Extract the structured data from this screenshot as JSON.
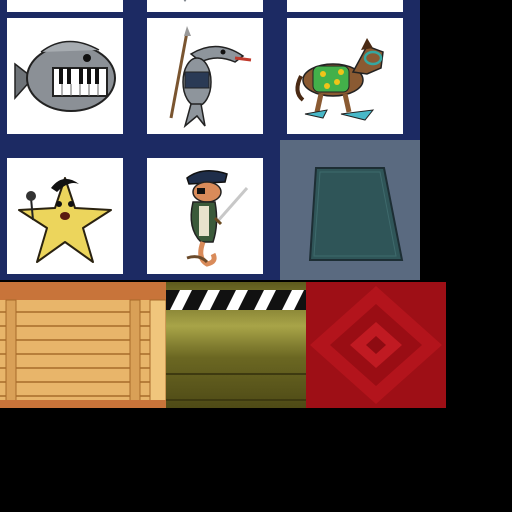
{
  "scene": "texture-atlas",
  "background_color": "#000000",
  "grid_line_color": "#1c2a63",
  "cards": [
    {
      "id": "card-top-left-peek",
      "icon": "partial-character-icon"
    },
    {
      "id": "card-top-middle-peek",
      "icon": "partial-character-icon"
    },
    {
      "id": "card-top-right-peek",
      "icon": "blank"
    },
    {
      "id": "piano-fish",
      "icon": "piano-fish-icon"
    },
    {
      "id": "swordfish-warrior",
      "icon": "swordfish-warrior-icon"
    },
    {
      "id": "scuba-horse",
      "icon": "scuba-horse-icon"
    },
    {
      "id": "elvis-starfish",
      "icon": "elvis-starfish-icon"
    },
    {
      "id": "pirate-seahorse",
      "icon": "pirate-seahorse-icon"
    }
  ],
  "tiles": [
    {
      "id": "empty-card-slot",
      "color": "#5a6a80",
      "inner_color": "#2f5558"
    },
    {
      "id": "wood-crate",
      "color": "#e8b56a"
    },
    {
      "id": "clapperboard",
      "color": "#7e7a2a"
    },
    {
      "id": "red-velvet",
      "color": "#9e0f16"
    }
  ]
}
